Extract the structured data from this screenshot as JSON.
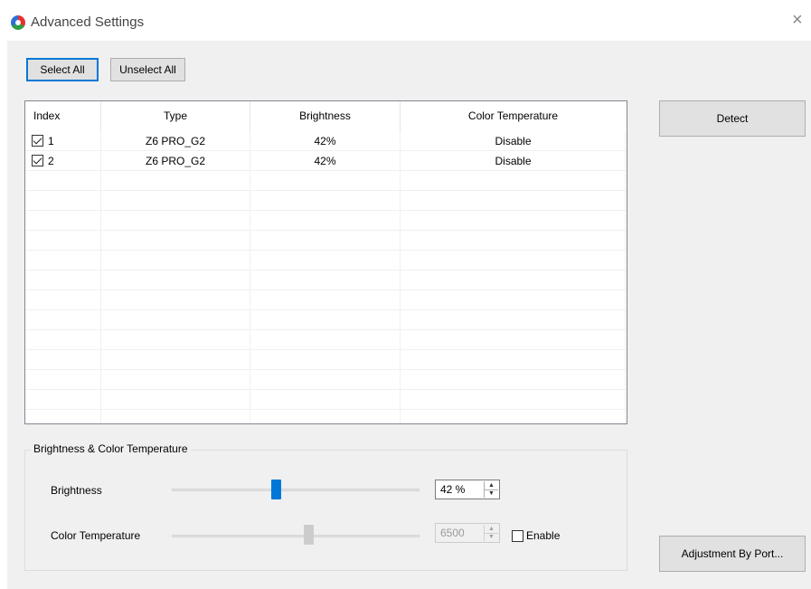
{
  "window": {
    "title": "Advanced Settings",
    "icon": "app-logo-icon",
    "close_icon": "close-icon",
    "close_glyph": "×"
  },
  "toolbar": {
    "select_all": "Select All",
    "unselect_all": "Unselect All"
  },
  "table": {
    "columns": [
      "Index",
      "Type",
      "Brightness",
      "Color Temperature"
    ],
    "rows": [
      {
        "checked": true,
        "index": "1",
        "type": "Z6 PRO_G2",
        "brightness": "42%",
        "color_temperature": "Disable"
      },
      {
        "checked": true,
        "index": "2",
        "type": "Z6 PRO_G2",
        "brightness": "42%",
        "color_temperature": "Disable"
      }
    ]
  },
  "detect_button": "Detect",
  "adjust_group": {
    "title": "Brightness & Color Temperature",
    "brightness": {
      "label": "Brightness",
      "value": "42 %",
      "level_percent": 42
    },
    "color_temperature": {
      "label": "Color Temperature",
      "value": "6500",
      "enable_label": "Enable",
      "enabled": false
    }
  },
  "adjust_by_port_button": "Adjustment By Port...",
  "colors": {
    "accent": "#0078d7",
    "window_bg": "#f0f0f0"
  }
}
